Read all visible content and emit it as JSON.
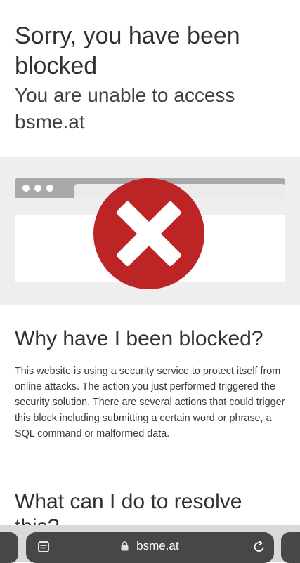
{
  "page": {
    "title": "Sorry, you have been blocked",
    "subtitle": "You are unable to access bsme.at"
  },
  "sections": [
    {
      "heading": "Why have I been blocked?",
      "body": "This website is using a security service to protect itself from online attacks. The action you just performed triggered the security solution. There are several actions that could trigger this block including submitting a certain word or phrase, a SQL command or malformed data."
    },
    {
      "heading": "What can I do to resolve this?"
    }
  ],
  "browser_toolbar": {
    "url": "bsme.at",
    "icons": [
      "tabs-icon",
      "lock-icon",
      "reload-icon"
    ]
  },
  "colors": {
    "error_red": "#bd2426",
    "toolbar_pill": "#474747",
    "band": "#eeeeee"
  }
}
